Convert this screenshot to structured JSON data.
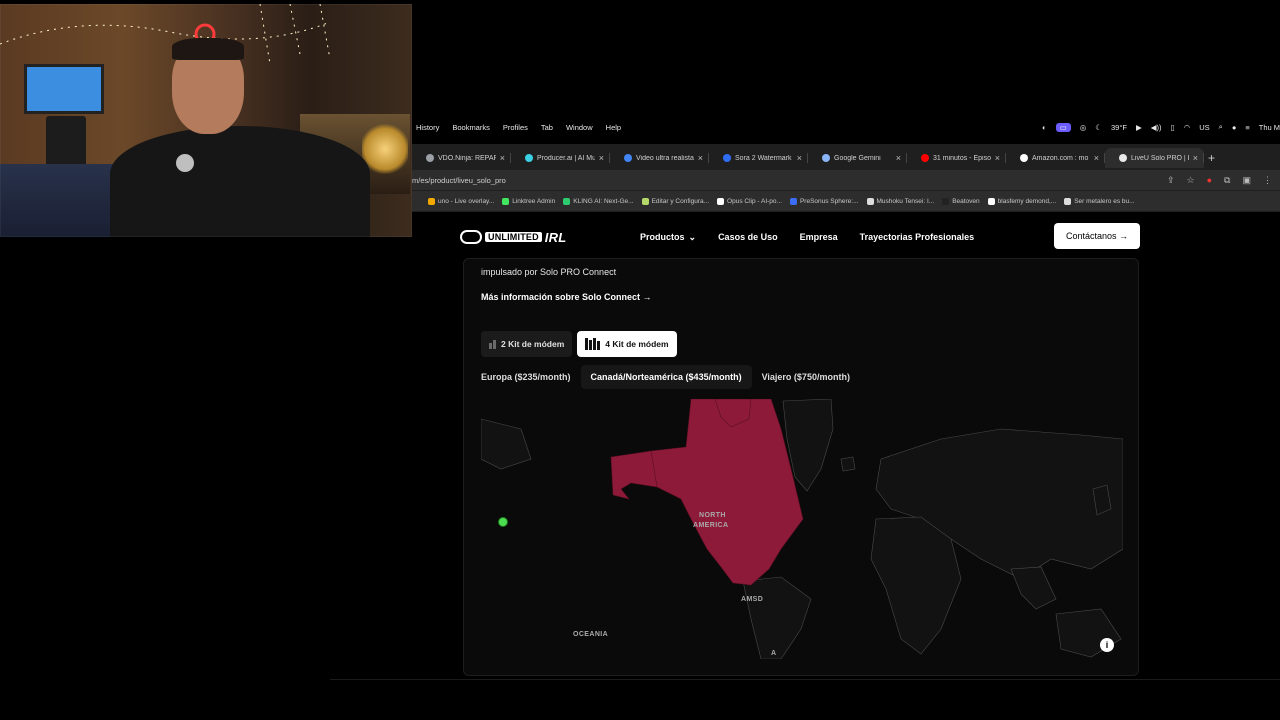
{
  "menubar": {
    "items": [
      "History",
      "Bookmarks",
      "Profiles",
      "Tab",
      "Window",
      "Help"
    ],
    "weather": "39°F",
    "clock": "Thu M",
    "input_label": "US"
  },
  "tabs": [
    {
      "label": "VDO.Ninja: REPAR",
      "color": "#9aa0a6",
      "active": false
    },
    {
      "label": "Producer.ai | AI Mu",
      "color": "#3bd1e5",
      "active": false
    },
    {
      "label": "Video ultra realista",
      "color": "#4285f4",
      "active": false
    },
    {
      "label": "Sora 2 Watermark",
      "color": "#2f6df6",
      "active": false
    },
    {
      "label": "Google Gemini",
      "color": "#8ab4f8",
      "active": false
    },
    {
      "label": "31 minutos - Episo",
      "color": "#ff0000",
      "active": false
    },
    {
      "label": "Amazon.com : mo",
      "color": "#ffffff",
      "active": false
    },
    {
      "label": "LiveU Solo PRO | Li",
      "color": "#e8e8e8",
      "active": true
    }
  ],
  "url": "m/es/product/liveu_solo_pro",
  "bookmarks": [
    {
      "label": "uno - Live overlay...",
      "color": "#f2a900"
    },
    {
      "label": "Linktree Admin",
      "color": "#43e660"
    },
    {
      "label": "KLING AI: Next-Ge...",
      "color": "#2ecc71"
    },
    {
      "label": "Editar y Configura...",
      "color": "#b5d86b"
    },
    {
      "label": "Opus Clip - AI-po...",
      "color": "#ffffff"
    },
    {
      "label": "PreSonus Sphere:...",
      "color": "#3b6ef5"
    },
    {
      "label": "Mushoku Tensei: I...",
      "color": "#dddddd"
    },
    {
      "label": "Beatoven",
      "color": "#222222"
    },
    {
      "label": "blasfemy demond,...",
      "color": "#ffffff"
    },
    {
      "label": "Ser metalero es bu...",
      "color": "#dddddd"
    }
  ],
  "site": {
    "logo_unlimited": "UNLIMITED",
    "logo_irl": "IRL",
    "nav": [
      "Productos",
      "Casos de Uso",
      "Empresa",
      "Trayectorias Profesionales"
    ],
    "cta": "Contáctanos →"
  },
  "card": {
    "powered": "impulsado por Solo PRO Connect",
    "more": "Más información sobre Solo Connect →",
    "kits": [
      {
        "label": "2 Kit de módem",
        "selected": false
      },
      {
        "label": "4 Kit de módem",
        "selected": true
      }
    ],
    "plans": [
      {
        "label": "Europa ($235/month)",
        "selected": false
      },
      {
        "label": "Canadá/Norteamérica ($435/month)",
        "selected": true
      },
      {
        "label": "Viajero ($750/month)",
        "selected": false
      }
    ],
    "map_labels": {
      "north": "NORTH",
      "america": "AMERICA",
      "oceania": "OCEANIA",
      "amsd": "AMSD",
      "a": "A"
    },
    "highlight_color": "#8e1a3a",
    "info": "i"
  }
}
